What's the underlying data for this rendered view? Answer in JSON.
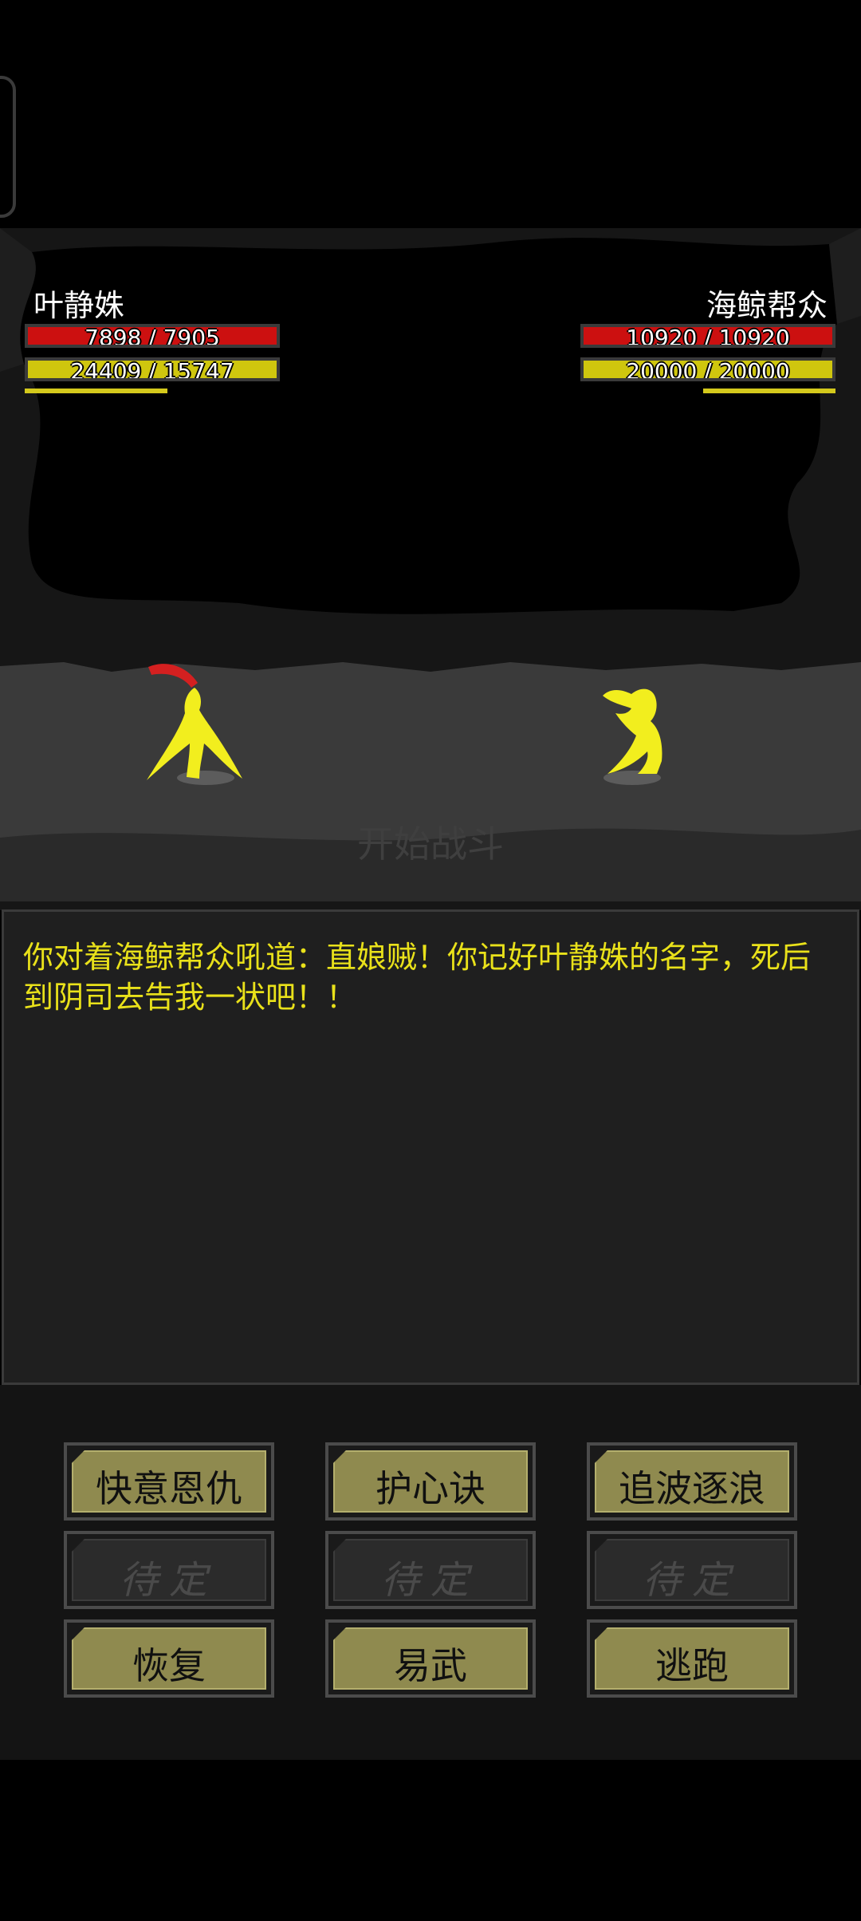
{
  "player": {
    "name": "叶静姝",
    "hp_text": "7898 / 7905",
    "hp_fraction": 0.999,
    "mp_text": "24409 / 15747",
    "mp_fraction": 1.0,
    "charge_fraction": 0.56
  },
  "enemy": {
    "name": "海鲸帮众",
    "hp_text": "10920 / 10920",
    "hp_fraction": 1.0,
    "mp_text": "20000 / 20000",
    "mp_fraction": 1.0,
    "charge_fraction": 0.52
  },
  "battle": {
    "status_text": "开始战斗"
  },
  "log": {
    "lines": "你对着海鲸帮众吼道：直娘贼！你记好叶静姝的名字，死后到阴司去告我一状吧！！"
  },
  "skills": [
    {
      "label": "快意恩仇",
      "enabled": true
    },
    {
      "label": "护心诀",
      "enabled": true
    },
    {
      "label": "追波逐浪",
      "enabled": true
    },
    {
      "label": "待定",
      "enabled": false
    },
    {
      "label": "待定",
      "enabled": false
    },
    {
      "label": "待定",
      "enabled": false
    },
    {
      "label": "恢复",
      "enabled": true
    },
    {
      "label": "易武",
      "enabled": true
    },
    {
      "label": "逃跑",
      "enabled": true
    }
  ],
  "colors": {
    "hp": "#cc1010",
    "mp": "#cfc60e",
    "character": "#f2ee1e",
    "weapon": "#d42020",
    "log_text": "#e9e11a",
    "button_face": "#8f8a4f"
  }
}
